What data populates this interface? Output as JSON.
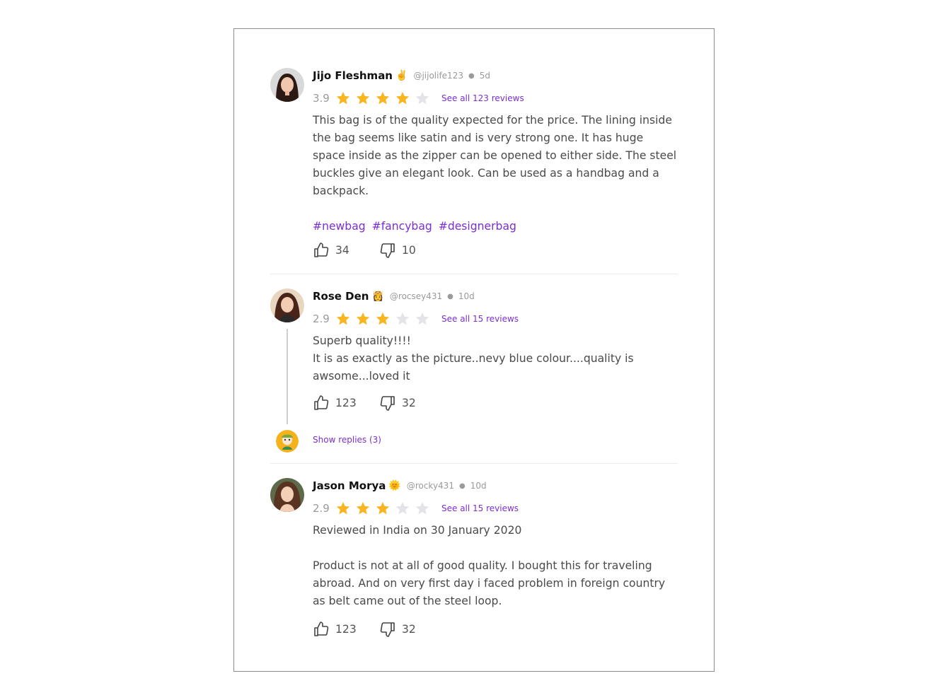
{
  "colors": {
    "accent": "#7b2fd1",
    "star_filled": "#f8b51f",
    "star_empty": "#e4e4e8",
    "muted": "#9a9a9a"
  },
  "reviews": [
    {
      "name": "Jijo Fleshman",
      "badge": "✌️",
      "handle": "@jijolife123",
      "time": "5d",
      "score": "3.9",
      "stars_filled": 4,
      "see_all": "See all 123 reviews",
      "body": [
        "This bag is of the quality expected for the price. The lining inside the bag seems like satin and is very strong one. It has huge space inside as the zipper can be opened to either side. The steel buckles give an elegant look. Can be used as a handbag and a backpack."
      ],
      "tags": [
        "#newbag",
        "#fancybag",
        "#designerbag"
      ],
      "likes": "34",
      "dislikes": "10",
      "avatar_icon": "avatar-woman-dark-hair"
    },
    {
      "name": "Rose Den",
      "badge": "👸",
      "handle": "@rocsey431",
      "time": "10d",
      "score": "2.9",
      "stars_filled": 3,
      "see_all": "See all 15 reviews",
      "body": [
        "Superb quality!!!!",
        "It is as exactly as the picture..nevy blue colour....quality is awsome...loved it"
      ],
      "likes": "123",
      "dislikes": "32",
      "show_replies": "Show replies (3)",
      "avatar_icon": "avatar-woman-brown-hair"
    },
    {
      "name": "Jason Morya",
      "badge": "🌞",
      "handle": "@rocky431",
      "time": "10d",
      "score": "2.9",
      "stars_filled": 3,
      "see_all": "See all 15 reviews",
      "body": [
        "Reviewed in India on 30 January 2020",
        "Product is not at all of good quality. I bought this for traveling abroad. And on very first day i faced problem in foreign country as belt came out of the steel loop."
      ],
      "likes": "123",
      "dislikes": "32",
      "avatar_icon": "avatar-woman-curly-hair"
    }
  ]
}
